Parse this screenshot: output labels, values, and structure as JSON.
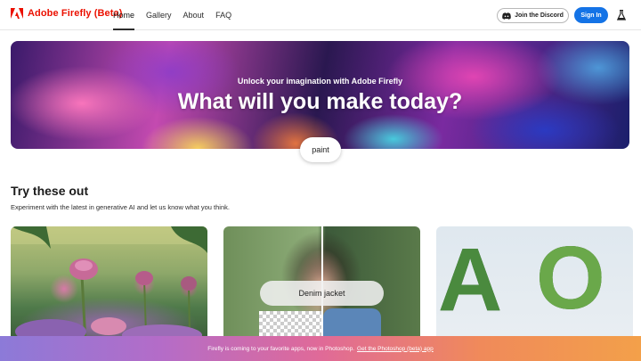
{
  "header": {
    "brand": "Adobe Firefly (Beta)",
    "nav": [
      "Home",
      "Gallery",
      "About",
      "FAQ"
    ],
    "discord_label": "Join the Discord",
    "signin_label": "Sign In"
  },
  "hero": {
    "subtitle": "Unlock your imagination with Adobe Firefly",
    "title": "What will you make today?",
    "prompt": "paint"
  },
  "section": {
    "title": "Try these out",
    "description": "Experiment with the latest in generative AI and let us know what you think."
  },
  "cards": [
    {
      "letters": ""
    },
    {
      "prompt": "Denim jacket"
    },
    {
      "letters": "AO"
    }
  ],
  "banner": {
    "text": "Firefly is coming to your favorite apps, now in Photoshop.",
    "link": "Get the Photoshop (beta) app"
  },
  "colors": {
    "brand_red": "#eb1000",
    "signin_blue": "#1473e6"
  },
  "icons": [
    "adobe-logo-icon",
    "discord-icon",
    "flask-icon"
  ]
}
